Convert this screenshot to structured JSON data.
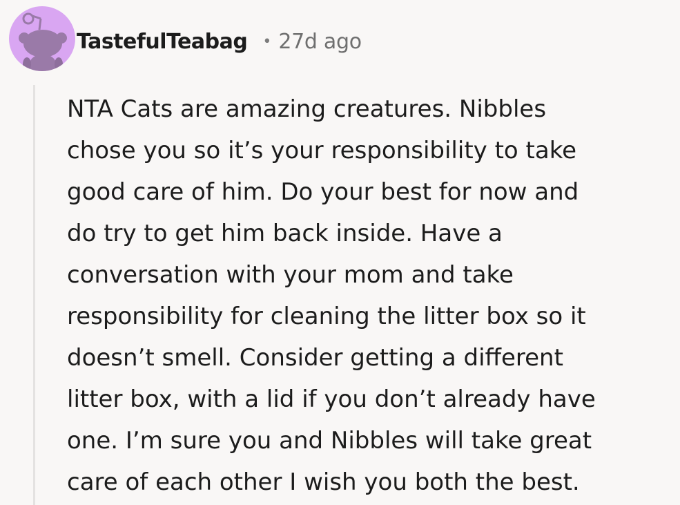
{
  "comment": {
    "author": "TastefulTeabag",
    "separator": "•",
    "time_ago": "27d ago",
    "avatar_icon": "snoo-avatar-icon",
    "avatar_bg": "#d9a6f2",
    "body_lines": [
      "NTA Cats are amazing creatures. Nibbles",
      "chose you so it’s your responsibility to take",
      "good care of him. Do your best for now and",
      "do try to get him back inside. Have a",
      "conversation with your mom and take",
      "responsibility for cleaning the litter box so it",
      "doesn’t smell. Consider getting a different",
      "litter box, with a lid if you don’t already have",
      "one. I’m sure you and Nibbles will take great",
      "care of each other I wish you both the best."
    ]
  }
}
